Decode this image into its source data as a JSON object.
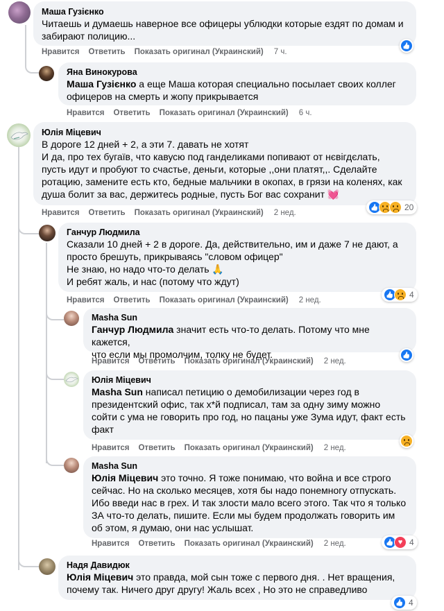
{
  "actions": {
    "like": "Нравится",
    "reply": "Ответить",
    "original": "Показать оригинал (Украинский)"
  },
  "comments": [
    {
      "author": "Маша Гузієнко",
      "lines": [
        "Читаешь и думаешь наверное все офицеры ублюдки которые ездят по домам и",
        "забирают полицию..."
      ],
      "time": "7 ч."
    },
    {
      "author": "Яна Винокурова",
      "mention": "Маша Гузієнко",
      "lines_after_mention": " а еще Маша которая специально посылает своих коллег",
      "lines": [
        "офицеров на смерть и жопу прикрывается"
      ],
      "time": "6 ч."
    },
    {
      "author": "Юлія Міцевич",
      "lines": [
        "В дороге 12 дней + 2, а эти 7. давать не хотят",
        "И да, про тех бугаїв, что кавусю под ганделиками попивают от нєвігдєлать,",
        "пусть идут и пробуют то счастье, деньги, которые ,,они платят,,. Сделайте",
        "ротацию, замените есть кто, бедные мальчики в окопах, в грязи на коленях, как",
        "душа болит за вас, держитесь родные, пусть Бог вас сохранит"
      ],
      "time": "2 нед.",
      "reaction_count": "20"
    },
    {
      "author": "Ганчур Людмила",
      "lines": [
        "Сказали 10 дней + 2 в дороге. Да, действительно, им и даже 7 не дают, а",
        "просто брешуть, прикрываясь \"словом офицер\"",
        "Не знаю, но надо что-то делать 🙏",
        "И ребят жаль, и нас (потому что ждут)"
      ],
      "time": "2 нед.",
      "reaction_count": "4"
    },
    {
      "author": "Masha Sun",
      "mention": "Ганчур Людмила",
      "lines_after_mention": " значит есть что-то делать. Потому что мне кажется,",
      "lines": [
        "что если мы промолчим, толку не будет."
      ],
      "time": "2 нед."
    },
    {
      "author": "Юлія Міцевич",
      "mention": "Masha Sun",
      "lines_after_mention": " написал петицию о демобилизации через год в",
      "lines": [
        "президентский офис, так х*й подписал, там за одну зиму можно",
        "сойти с ума не говорить про год, но пацаны уже Зума идут, факт есть",
        "факт"
      ],
      "time": "2 нед."
    },
    {
      "author": "Masha Sun",
      "mention": "Юлія Міцевич",
      "lines_after_mention": " это точно. Я тоже понимаю, что война и все строго",
      "lines": [
        "сейчас. Но на сколько месяцев, хотя бы надо понемногу отпускать.",
        "Ибо введи нас в грех. И так злости мало всего этого. Так что я только",
        "ЗА что-то делать, пишите. Если мы будем продолжать говорить им",
        "об этом, я думаю, они нас услышат."
      ],
      "time": "2 нед.",
      "reaction_count": "4"
    },
    {
      "author": "Надя Давидюк",
      "mention": "Юлія Міцевич",
      "lines_after_mention": " это правда, мой сын тоже с первого дня. . Нет вращения,",
      "lines": [
        "почему так. Ничего друг другу! Жаль всех , Но это не справедливо"
      ],
      "time": "2 нед.",
      "reaction_count": "4"
    }
  ],
  "colors": {
    "bubble": "#f0f2f5",
    "meta": "#65676b",
    "like": "#1877f2"
  }
}
